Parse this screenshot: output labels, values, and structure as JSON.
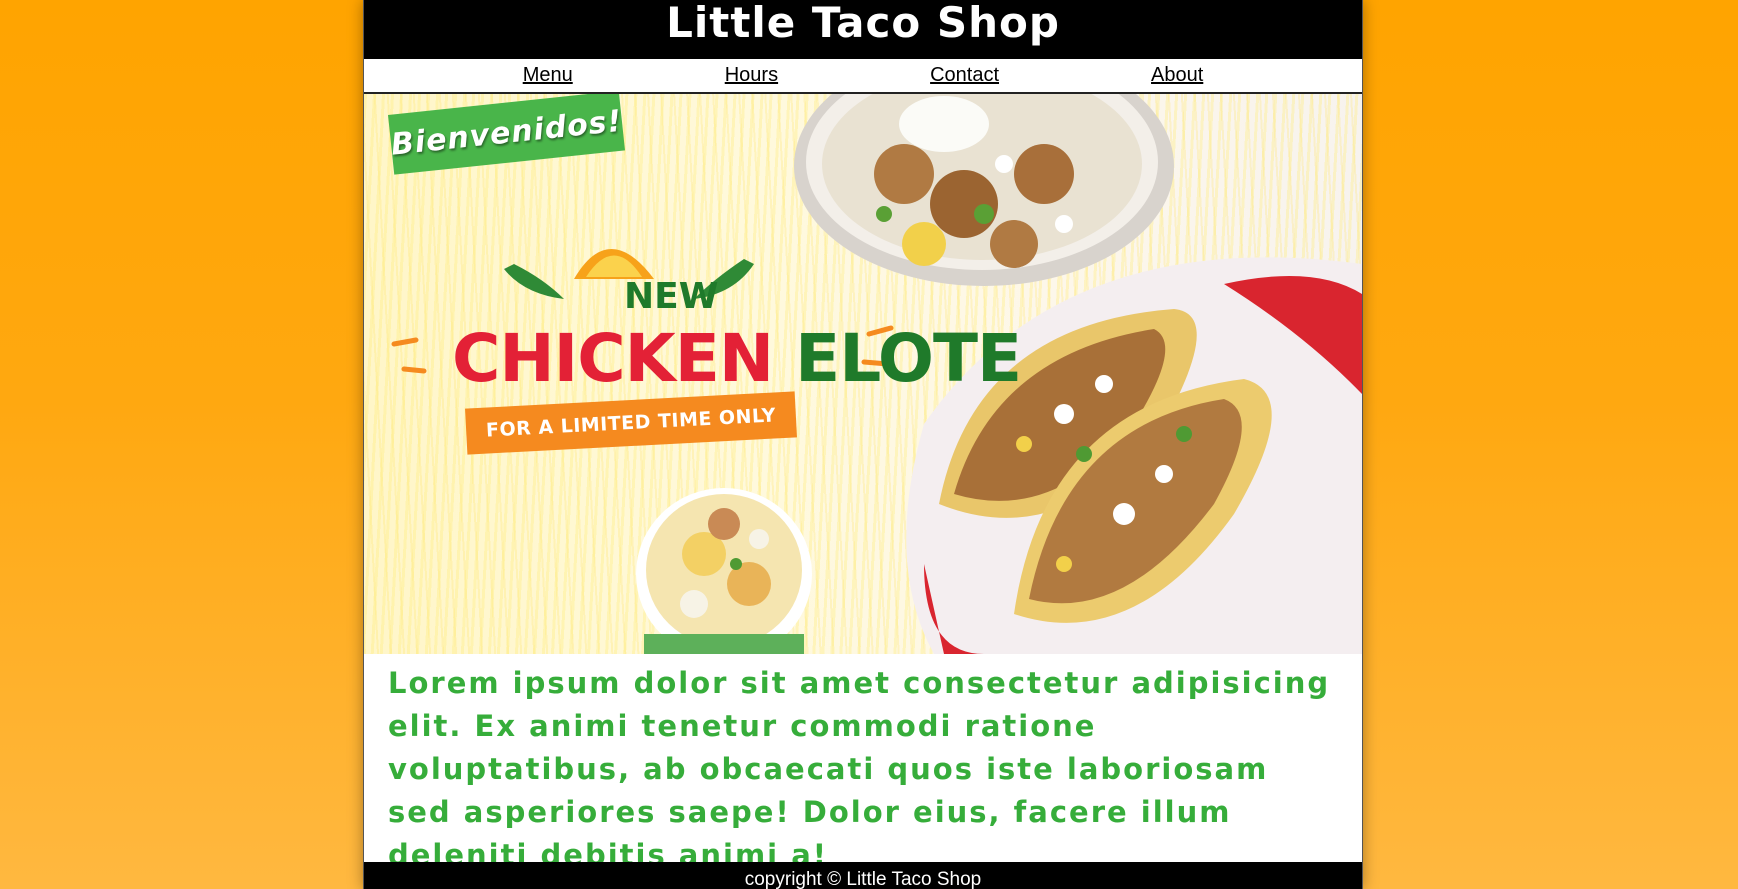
{
  "header": {
    "title": "Little Taco Shop"
  },
  "nav": {
    "items": [
      "Menu",
      "Hours",
      "Contact",
      "About"
    ]
  },
  "hero": {
    "badge": "Bienvenidos!",
    "promo_new": "NEW",
    "promo_word1": "CHICKEN",
    "promo_word2": "ELOTE",
    "promo_sub": "FOR A LIMITED TIME ONLY"
  },
  "content": {
    "paragraph": "Lorem ipsum dolor sit amet consectetur adipisicing elit. Ex animi tenetur commodi ratione voluptatibus, ab obcaecati quos iste laboriosam sed asperiores saepe! Dolor eius, facere illum deleniti debitis animi a!"
  },
  "footer": {
    "copyright": "copyright © Little Taco Shop"
  },
  "colors": {
    "background": "#ffa400",
    "header": "#000000",
    "text_green": "#36ad3a",
    "badge_green": "#49b54a",
    "promo_red": "#e32136",
    "promo_green": "#1f7a2a",
    "promo_orange": "#f58a1f"
  }
}
